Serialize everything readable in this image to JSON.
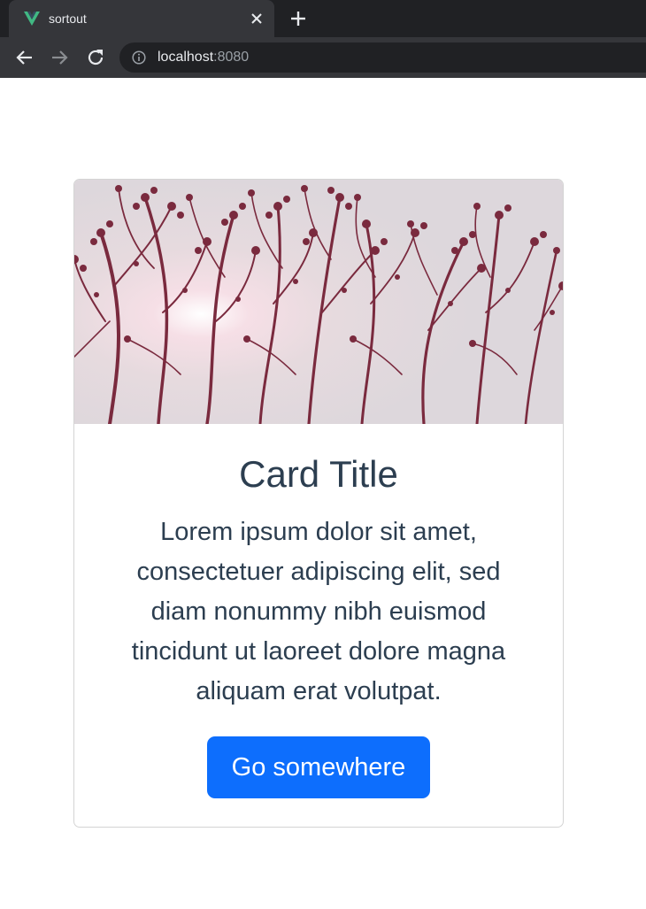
{
  "browser": {
    "tab": {
      "title": "sortout",
      "favicon": "vue-logo-icon",
      "close_icon": "close-icon"
    },
    "new_tab_icon": "plus-icon",
    "toolbar": {
      "back_icon": "back-arrow-icon",
      "forward_icon": "forward-arrow-icon",
      "reload_icon": "reload-icon",
      "info_icon": "info-icon",
      "url_host": "localhost",
      "url_port": ":8080"
    },
    "colors": {
      "tab_strip": "#202124",
      "active_tab": "#35363a",
      "omnibox": "#202124"
    }
  },
  "card": {
    "image": "tree-branches-photo",
    "title": "Card Title",
    "text": "Lorem ipsum dolor sit amet, consectetuer adipiscing elit, sed diam nonummy nibh euismod tincidunt ut laoreet dolore magna aliquam erat volutpat.",
    "button_label": "Go somewhere",
    "colors": {
      "text": "#2c3e50",
      "button": "#0d6efd",
      "button_text": "#ffffff",
      "border": "#d4d4d4"
    }
  }
}
